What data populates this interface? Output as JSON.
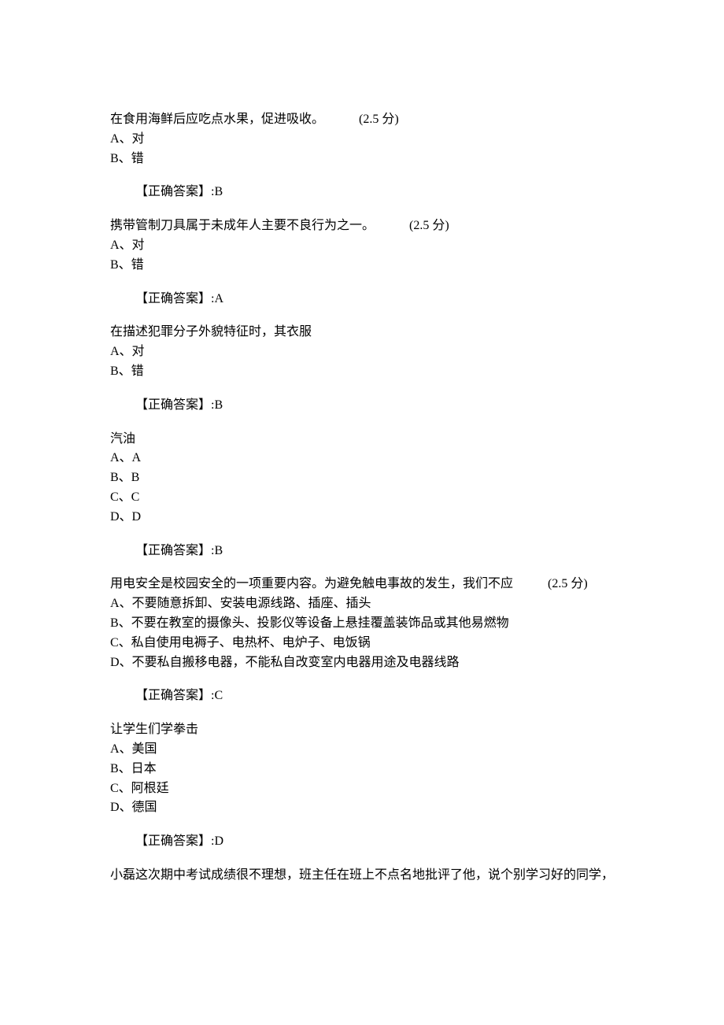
{
  "questions": [
    {
      "text": "在食用海鲜后应吃点水果，促进吸收。",
      "pad": "           ",
      "score": "(2.5 分)",
      "options": [
        "A、对",
        "B、错"
      ],
      "answer": "【正确答案】:B"
    },
    {
      "text": "携带管制刀具属于未成年人主要不良行为之一。",
      "pad": "           ",
      "score": "(2.5 分)",
      "options": [
        "A、对",
        "B、错"
      ],
      "answer": "【正确答案】:A"
    },
    {
      "text": "在描述犯罪分子外貌特征时，其衣服",
      "pad": "",
      "score": "",
      "options": [
        "A、对",
        "B、错"
      ],
      "answer": "【正确答案】:B"
    },
    {
      "text": "汽油",
      "pad": "",
      "score": "",
      "options": [
        "A、A",
        "B、B",
        "C、C",
        "D、D"
      ],
      "answer": "【正确答案】:B"
    },
    {
      "text": "用电安全是校园安全的一项重要内容。为避免触电事故的发生，我们不应",
      "pad": "           ",
      "score": "(2.5 分)",
      "options": [
        "A、不要随意拆卸、安装电源线路、插座、插头",
        "B、不要在教室的摄像头、投影仪等设备上悬挂覆盖装饰品或其他易燃物",
        "C、私自使用电褥子、电热杯、电炉子、电饭锅",
        "D、不要私自搬移电器，不能私自改变室内电器用途及电器线路"
      ],
      "answer": "【正确答案】:C"
    },
    {
      "text": "让学生们学拳击",
      "pad": "",
      "score": "",
      "options": [
        "A、美国",
        "B、日本",
        "C、阿根廷",
        "D、德国"
      ],
      "answer": "【正确答案】:D"
    }
  ],
  "trailing": "小磊这次期中考试成绩很不理想，班主任在班上不点名地批评了他，说个别学习好的同学，"
}
